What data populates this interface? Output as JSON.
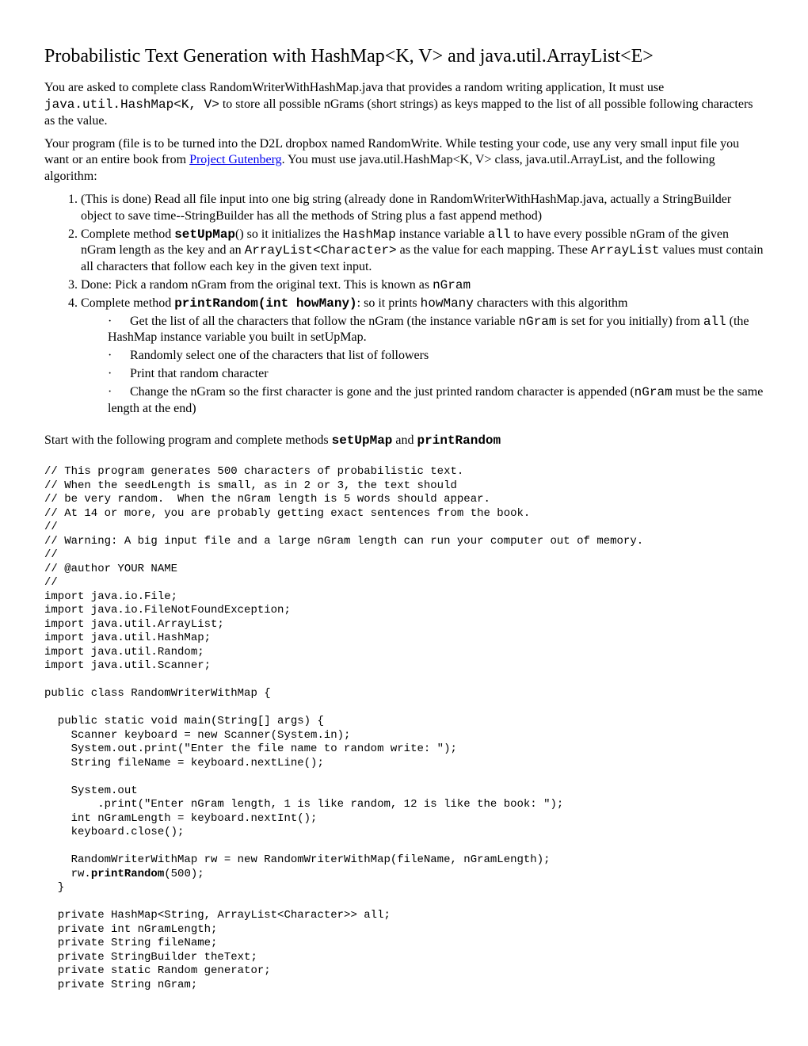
{
  "title": "Probabilistic Text Generation with HashMap<K, V> and java.util.ArrayList<E>",
  "para1_a": "You are asked to complete class RandomWriterWithHashMap.java that provides a random writing application, It must use ",
  "para1_mono": "java.util.HashMap<K, V>",
  "para1_b": " to store all possible nGrams (short strings) as keys mapped to the list of all possible following characters as the value.",
  "para2_a": "Your program (file is to be turned into the D2L dropbox named RandomWrite. While testing your code, use any very small input file you want or an entire book from ",
  "para2_link": "Project Gutenberg",
  "para2_b": ". You must use java.util.HashMap<K, V> class, java.util.ArrayList, and the following algorithm:",
  "li1": "(This is done) Read all file input into one big string (already done in RandomWriterWithHashMap.java, actually a StringBuilder object to save time--StringBuilder has all the methods of String plus a fast append method)",
  "li2_a": "Complete method ",
  "li2_b": "setUpMap",
  "li2_c": "() so it initializes the ",
  "li2_d": "HashMap",
  "li2_e": " instance variable ",
  "li2_f": "all",
  "li2_g": " to have every possible nGram of the given nGram length as the key and an ",
  "li2_h": "ArrayList<Character>",
  "li2_i": " as the value for each mapping. These ",
  "li2_j": "ArrayList",
  "li2_k": " values must contain all characters that follow each key in the given text input.",
  "li3_a": "Done: Pick a random nGram from the original text.  This is known as ",
  "li3_b": "nGram",
  "li4_a": "Complete method ",
  "li4_b": "printRandom(int howMany)",
  "li4_c": ": so it prints ",
  "li4_d": "howMany",
  "li4_e": " characters with this algorithm",
  "sub1_a": "Get the list of all the characters that follow the nGram (the instance variable ",
  "sub1_b": "nGram",
  "sub1_c": "  is set for you initially) from ",
  "sub1_d": "all",
  "sub1_e": "  (the HashMap instance variable you built in setUpMap.",
  "sub2": "Randomly select one of the characters that list of followers",
  "sub3": "Print that random character",
  "sub4_a": "Change the nGram so the first character is gone and the just printed random character is appended (",
  "sub4_b": "nGram",
  "sub4_c": " must be the same length at the end)",
  "start_a": "Start with the following program and complete methods ",
  "start_b": "setUpMap",
  "start_c": " and ",
  "start_d": " printRandom",
  "code": "// This program generates 500 characters of probabilistic text.\n// When the seedLength is small, as in 2 or 3, the text should\n// be very random.  When the nGram length is 5 words should appear.\n// At 14 or more, you are probably getting exact sentences from the book.\n//\n// Warning: A big input file and a large nGram length can run your computer out of memory.\n//\n// @author YOUR NAME\n//\nimport java.io.File;\nimport java.io.FileNotFoundException;\nimport java.util.ArrayList;\nimport java.util.HashMap;\nimport java.util.Random;\nimport java.util.Scanner;\n\npublic class RandomWriterWithMap {\n\n  public static void main(String[] args) {\n    Scanner keyboard = new Scanner(System.in);\n    System.out.print(\"Enter the file name to random write: \");\n    String fileName = keyboard.nextLine();\n\n    System.out\n        .print(\"Enter nGram length, 1 is like random, 12 is like the book: \");\n    int nGramLength = keyboard.nextInt();\n    keyboard.close();\n\n    RandomWriterWithMap rw = new RandomWriterWithMap(fileName, nGramLength);\n    rw.printRandom(500);\n  }\n\n  private HashMap<String, ArrayList<Character>> all;\n  private int nGramLength;\n  private String fileName;\n  private StringBuilder theText;\n  private static Random generator;\n  private String nGram;",
  "code_bold": "printRandom"
}
